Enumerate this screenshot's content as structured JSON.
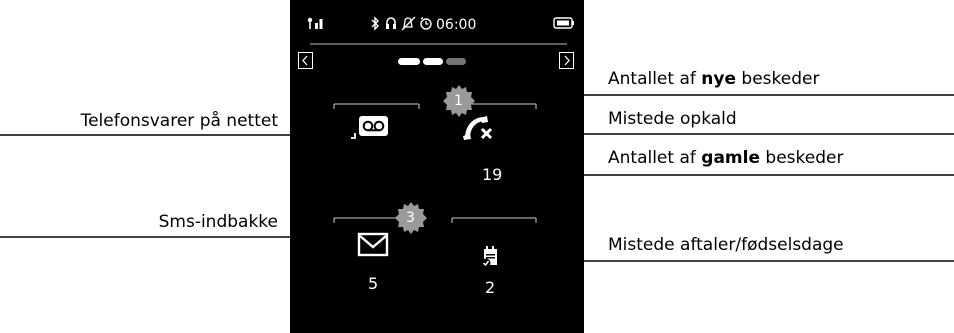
{
  "status_bar": {
    "time": "06:00",
    "icons": [
      "signal-icon",
      "bluetooth-icon",
      "headset-icon",
      "ringer-off-icon",
      "alarm-clock-icon",
      "battery-icon"
    ]
  },
  "pagination": {
    "pages": 3,
    "active": 1
  },
  "tiles": {
    "voicemail": {
      "icon": "voicemail-icon"
    },
    "missed_calls": {
      "icon": "missed-call-icon",
      "badge": "1",
      "count": "19"
    },
    "sms": {
      "icon": "envelope-icon",
      "badge": "3",
      "count": "5"
    },
    "appointments": {
      "icon": "calendar-check-icon",
      "count": "2"
    }
  },
  "labels": {
    "network_voicemail": "Telefonsvarer på nettet",
    "sms_inbox": "Sms-indbakke",
    "new_messages_pre": "Antallet af ",
    "new_messages_bold": "nye",
    "new_messages_post": " beskeder",
    "missed_calls": "Mistede opkald",
    "old_messages_pre": "Antallet af ",
    "old_messages_bold": "gamle",
    "old_messages_post": " beskeder",
    "missed_appointments": "Mistede aftaler/fødselsdage"
  },
  "colors": {
    "screen": "#000000",
    "badge": "#9a9a9a",
    "text": "#000000"
  }
}
